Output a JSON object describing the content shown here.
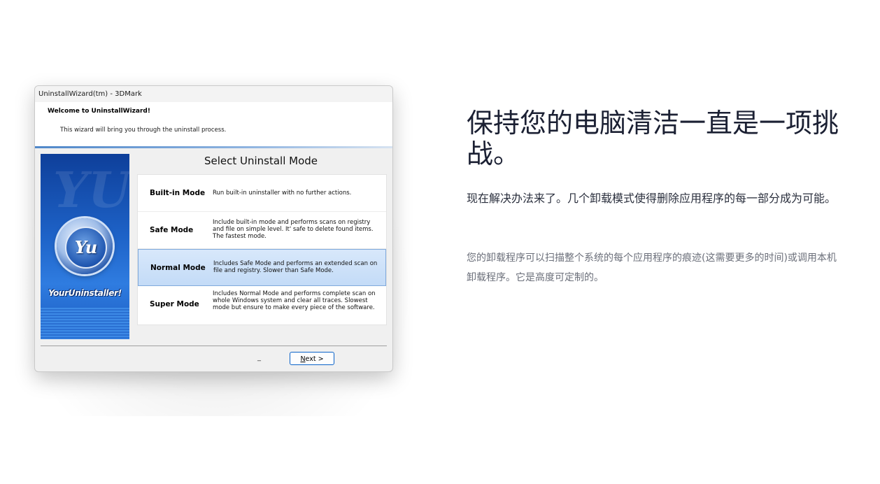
{
  "window": {
    "title": "UninstallWizard(tm) - 3DMark",
    "header_title": "Welcome to UninstallWizard!",
    "header_subtitle": "This wizard will bring you through the uninstall process."
  },
  "banner": {
    "logo_text": "Yu",
    "brand": "YourUninstaller!"
  },
  "select_mode": {
    "title": "Select Uninstall Mode",
    "modes": [
      {
        "name": "Built-in Mode",
        "desc": "Run built-in uninstaller with no further actions.",
        "selected": false
      },
      {
        "name": "Safe Mode",
        "desc": "Include built-in mode and performs scans on registry and file on simple level. It' safe to delete found items. The fastest mode.",
        "selected": false
      },
      {
        "name": "Normal Mode",
        "desc": "Includes Safe Mode and performs an extended scan on file and registry. Slower than Safe Mode.",
        "selected": true
      },
      {
        "name": "Super Mode",
        "desc": "Includes Normal Mode and performs complete scan on whole Windows system and clear all traces. Slowest mode but ensure to make every piece of the software.",
        "selected": false
      }
    ]
  },
  "footer": {
    "underscore": "_",
    "next_hotkey": "N",
    "next_rest": "ext >"
  },
  "marketing": {
    "headline": "保持您的电脑清洁一直是一项挑战。",
    "subheadline": "现在解决办法来了。几个卸载模式使得删除应用程序的每一部分成为可能。",
    "body": "您的卸载程序可以扫描整个系统的每个应用程序的痕迹(这需要更多的时间)或调用本机卸载程序。它是高度可定制的。"
  },
  "colors": {
    "accent": "#0a62c9",
    "selected_row": "#c3dbf7",
    "headline": "#1b2033",
    "body_gray": "#6b6f7a"
  }
}
